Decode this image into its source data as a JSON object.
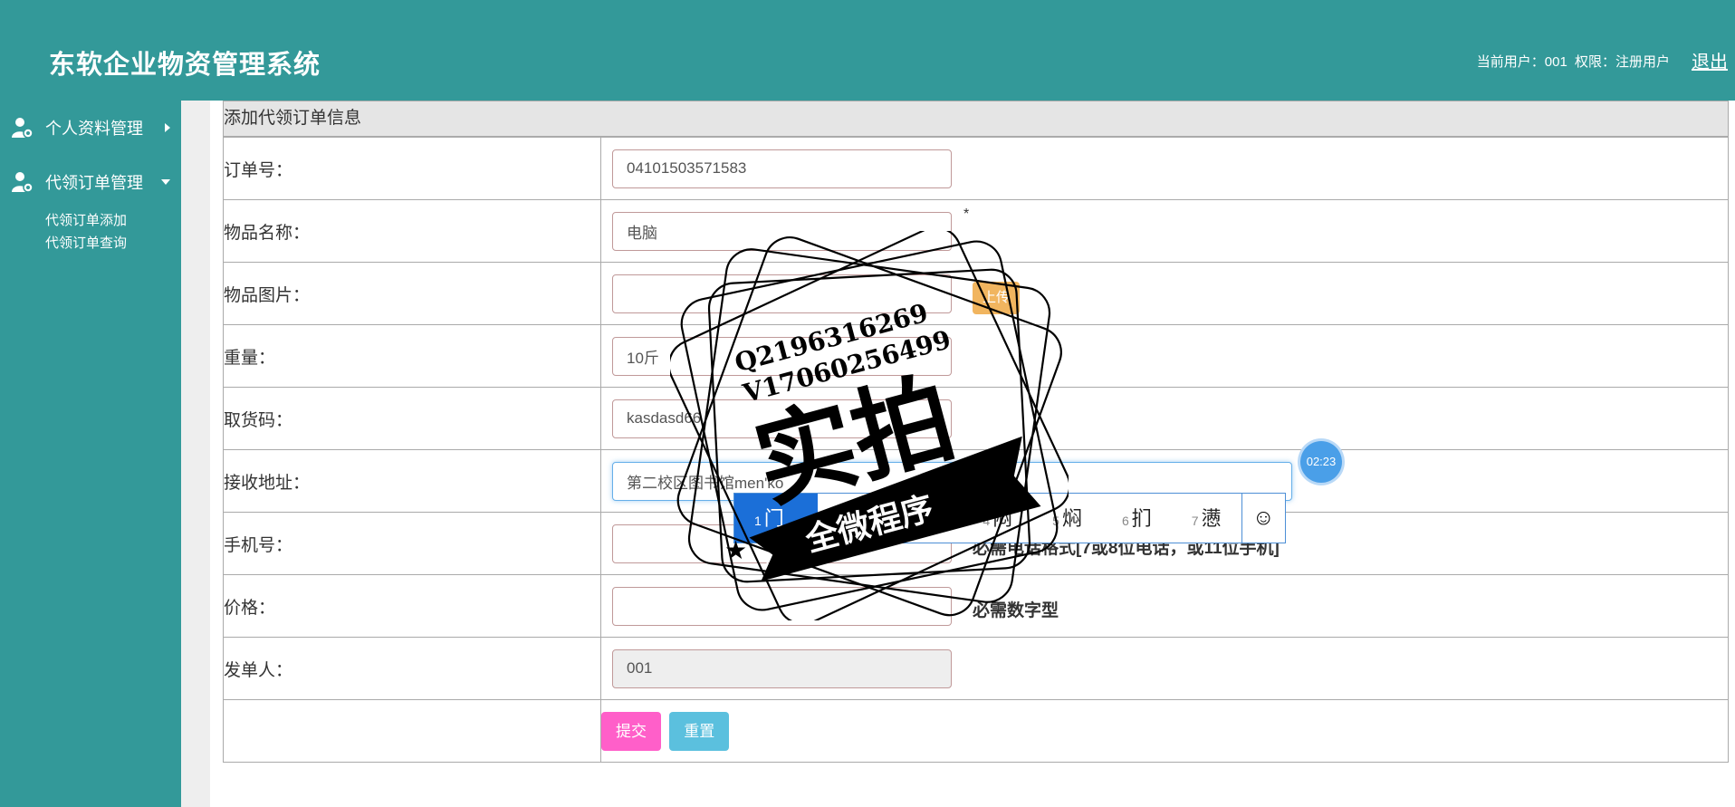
{
  "header": {
    "title": "东软企业物资管理系统",
    "user_label": "当前用户：001",
    "role_label": "权限：注册用户",
    "logout": "退出"
  },
  "sidebar": {
    "groups": [
      {
        "label": "个人资料管理",
        "icon": "user-gear-icon",
        "expanded": false
      },
      {
        "label": "代领订单管理",
        "icon": "user-gear-icon",
        "expanded": true
      }
    ],
    "sub_items": [
      "代领订单添加",
      "代领订单查询"
    ]
  },
  "form": {
    "title": "添加代领订单信息",
    "rows": [
      {
        "label": "订单号：",
        "value": "04101503571583"
      },
      {
        "label": "物品名称：",
        "value": "电脑",
        "required_mark": "*"
      },
      {
        "label": "物品图片：",
        "value": "",
        "upload_label": "上传"
      },
      {
        "label": "重量：",
        "value": "10斤"
      },
      {
        "label": "取货码：",
        "value": "kasdasd66"
      },
      {
        "label": "接收地址：",
        "value": "第二校区图书馆men'ko"
      },
      {
        "label": "手机号：",
        "value": "",
        "hint": "必需电话格式[7或8位电话，或11位手机]"
      },
      {
        "label": "价格：",
        "value": "",
        "hint": "必需数字型"
      },
      {
        "label": "发单人：",
        "value": "001"
      }
    ],
    "submit": "提交",
    "reset": "重置"
  },
  "ime": {
    "candidates": [
      {
        "num": "1",
        "text": "门口",
        "selected": true
      },
      {
        "num": "4",
        "text": "闷"
      },
      {
        "num": "5",
        "text": "焖"
      },
      {
        "num": "6",
        "text": "扪"
      },
      {
        "num": "7",
        "text": "懑"
      }
    ],
    "emoji": "☺"
  },
  "timer": "02:23",
  "watermark": {
    "line1": "Q2196316269",
    "line2": "V17060256499",
    "main": "实拍",
    "ribbon": "全微程序"
  },
  "colors": {
    "teal": "#339999",
    "submit": "#ff5fc9",
    "reset": "#5bc0de",
    "upload": "#f0ad4e"
  }
}
